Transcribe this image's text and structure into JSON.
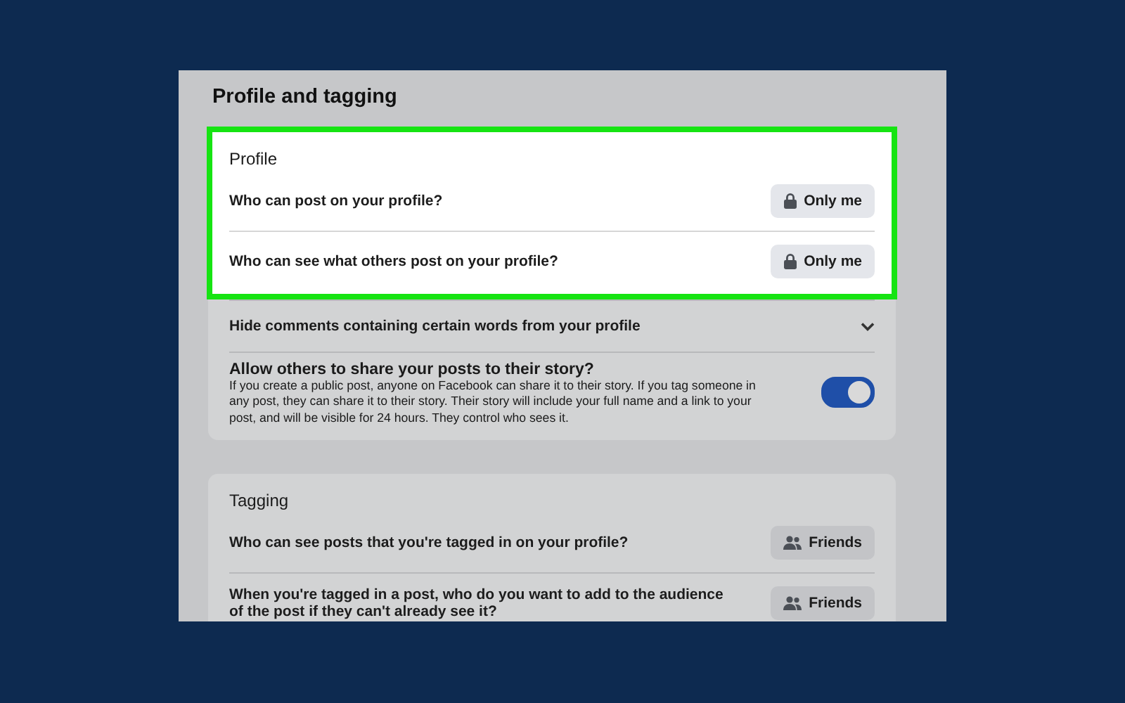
{
  "page_title": "Profile and tagging",
  "sections": [
    {
      "title": "Profile",
      "highlighted": true,
      "items": [
        {
          "kind": "locked",
          "label": "Who can post on your profile?",
          "value": "Only me"
        },
        {
          "kind": "locked",
          "label": "Who can see what others post on your profile?",
          "value": "Only me"
        }
      ],
      "more_items": [
        {
          "kind": "expand",
          "label": "Hide comments containing certain words from your profile",
          "expanded": false
        },
        {
          "kind": "toggle",
          "label": "Allow others to share your posts to their story?",
          "description": "If you create a public post, anyone on Facebook can share it to their story. If you tag someone in any post, they can share it to their story. Their story will include your full name and a link to your post, and will be visible for 24 hours. They control who sees it.",
          "on": true
        }
      ]
    },
    {
      "title": "Tagging",
      "highlighted": false,
      "items": [
        {
          "kind": "audience",
          "label": "Who can see posts that you're tagged in on your profile?",
          "value": "Friends"
        },
        {
          "kind": "audience",
          "label": "When you're tagged in a post, who do you want to add to the audience of the post if they can't already see it?",
          "value": "Friends"
        }
      ]
    }
  ]
}
